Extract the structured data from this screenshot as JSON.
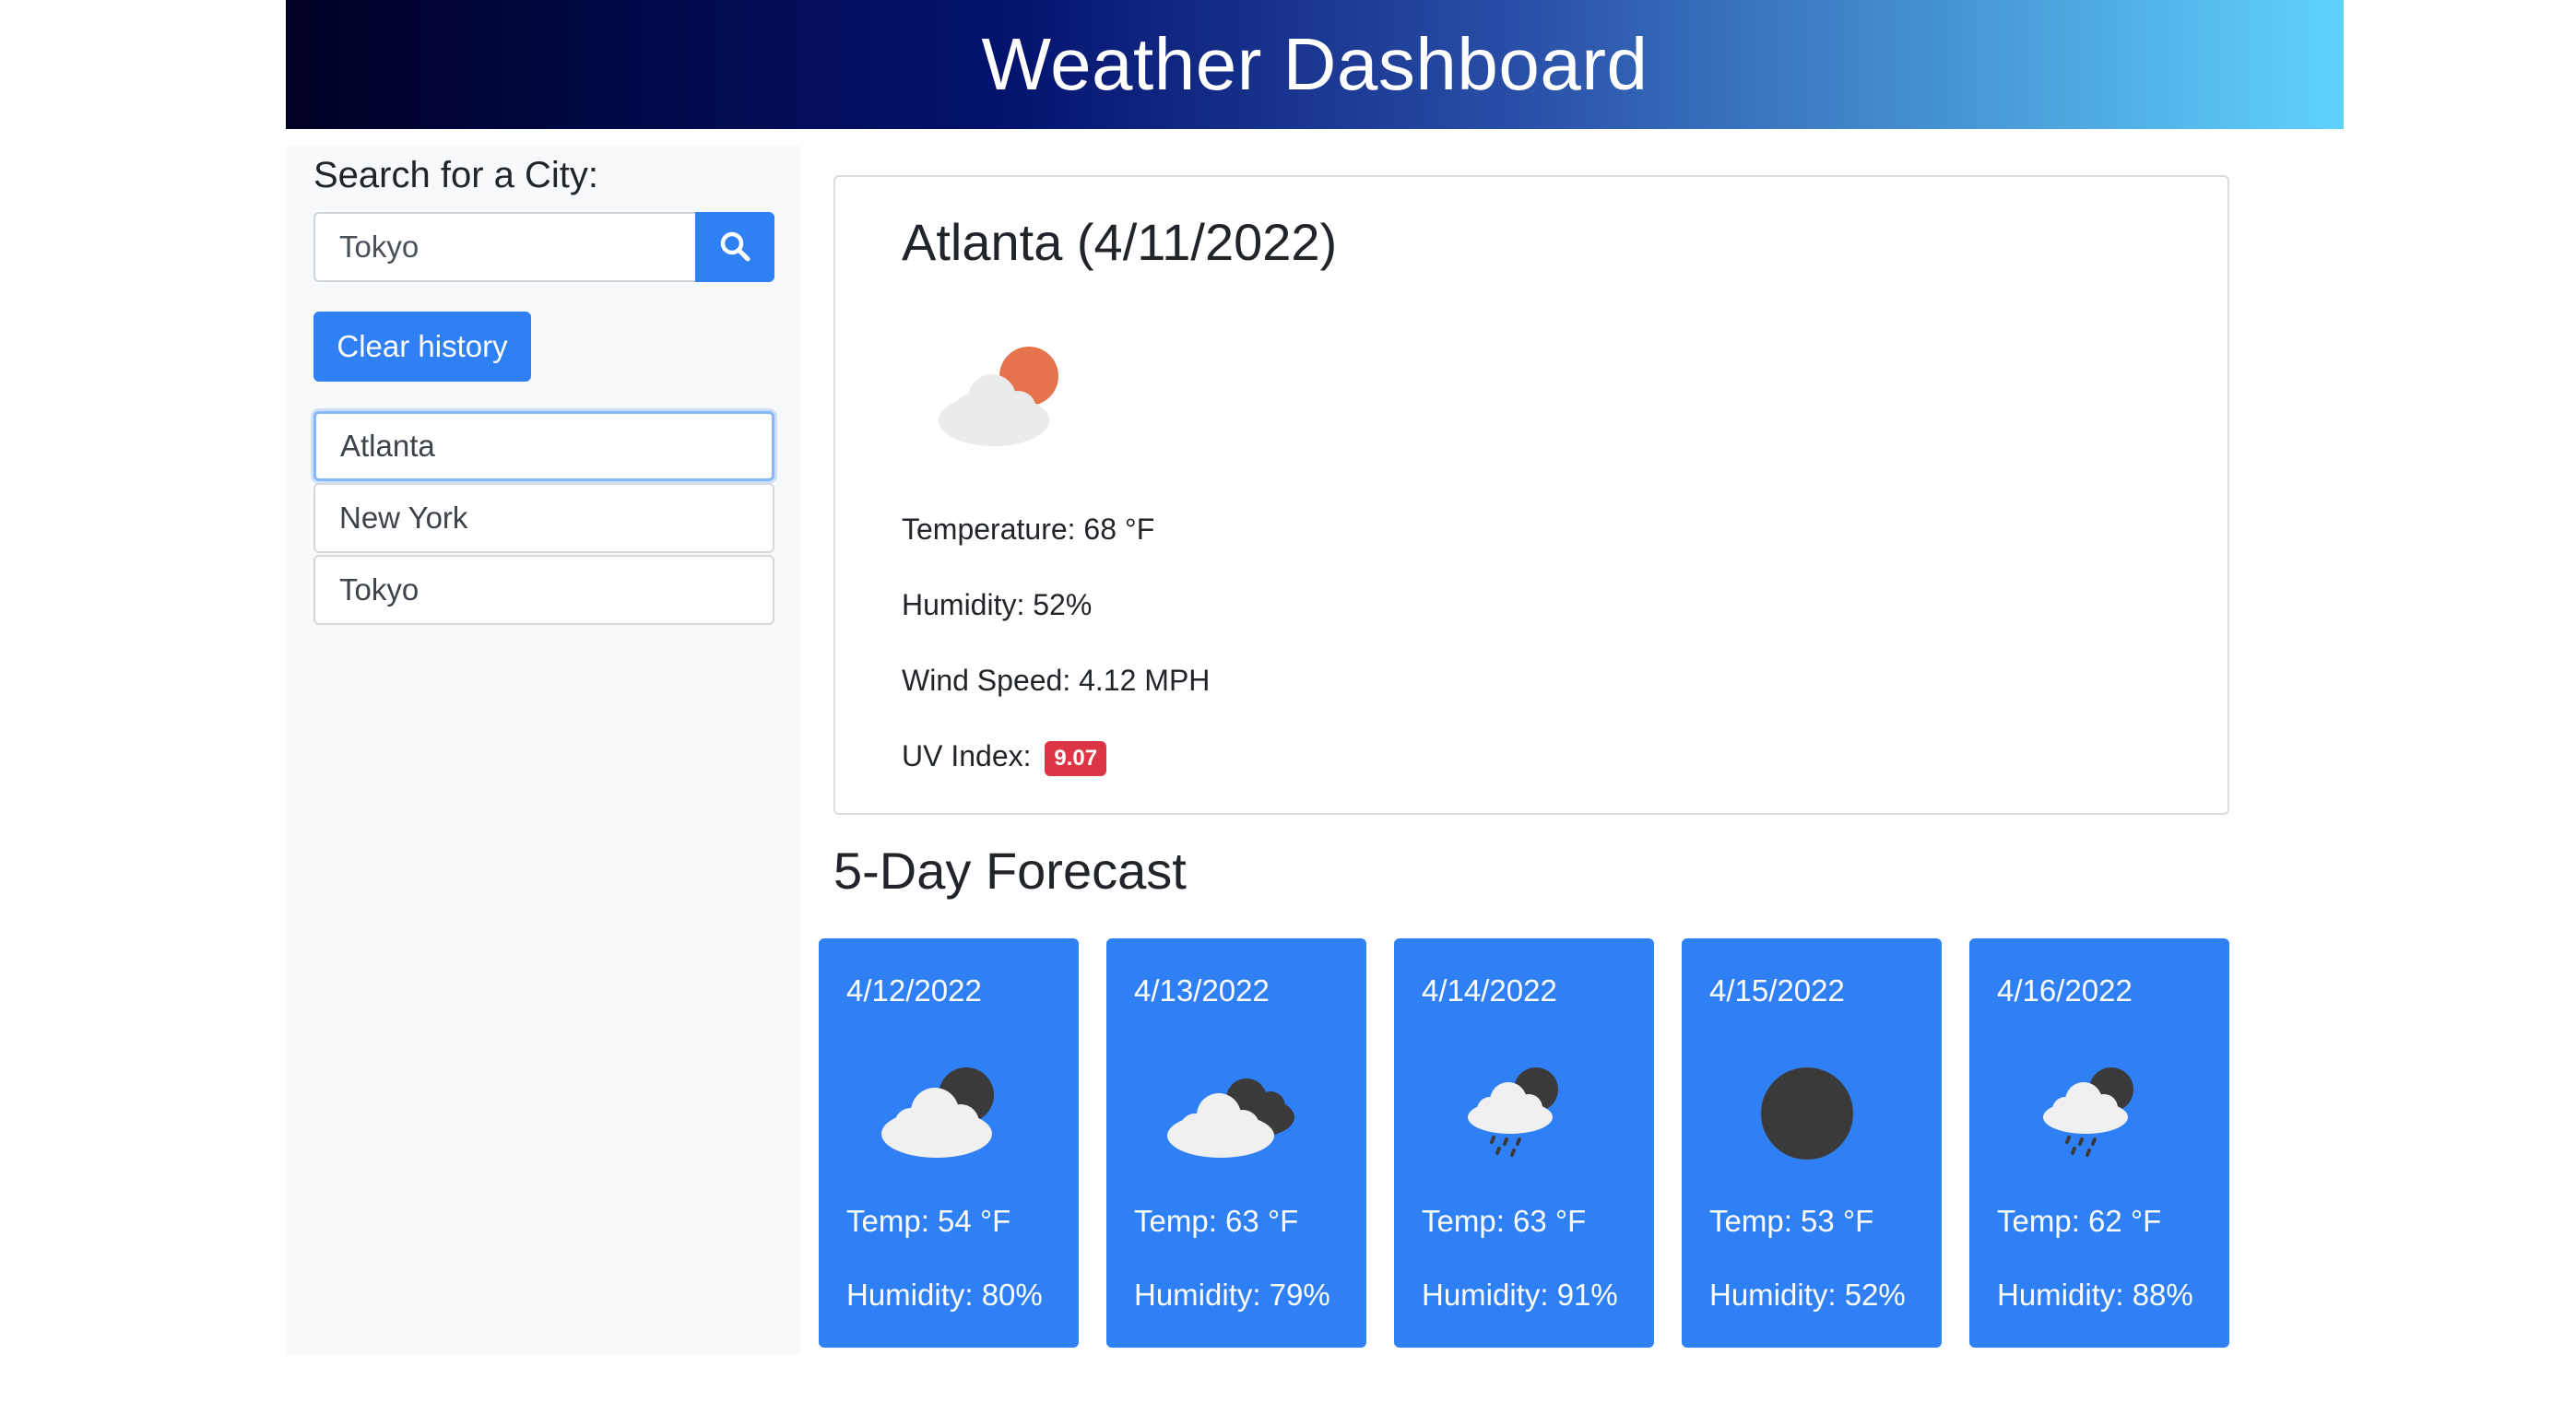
{
  "header": {
    "title": "Weather Dashboard"
  },
  "search": {
    "label": "Search for a City:",
    "value": "Tokyo",
    "button_icon": "search-icon",
    "clear_label": "Clear history"
  },
  "history": [
    {
      "label": "Atlanta",
      "active": true
    },
    {
      "label": "New York",
      "active": false
    },
    {
      "label": "Tokyo",
      "active": false
    }
  ],
  "current": {
    "title": "Atlanta (4/11/2022)",
    "icon": "partly-cloudy-icon",
    "temperature": "Temperature: 68 °F",
    "humidity": "Humidity: 52%",
    "wind": "Wind Speed: 4.12 MPH",
    "uv_label": "UV Index:",
    "uv_value": "9.07"
  },
  "forecast": {
    "title": "5-Day Forecast",
    "days": [
      {
        "date": "4/12/2022",
        "icon": "cloudy-night-icon",
        "temp": "Temp: 54 °F",
        "humidity": "Humidity: 80%"
      },
      {
        "date": "4/13/2022",
        "icon": "broken-clouds-icon",
        "temp": "Temp: 63 °F",
        "humidity": "Humidity: 79%"
      },
      {
        "date": "4/14/2022",
        "icon": "rain-night-icon",
        "temp": "Temp: 63 °F",
        "humidity": "Humidity: 91%"
      },
      {
        "date": "4/15/2022",
        "icon": "clear-night-icon",
        "temp": "Temp: 53 °F",
        "humidity": "Humidity: 52%"
      },
      {
        "date": "4/16/2022",
        "icon": "rain-night-icon",
        "temp": "Temp: 62 °F",
        "humidity": "Humidity: 88%"
      }
    ]
  },
  "colors": {
    "primary": "#2f7ff5",
    "uv_badge": "#dc3545",
    "sidebar_bg": "#f8f9fa"
  }
}
